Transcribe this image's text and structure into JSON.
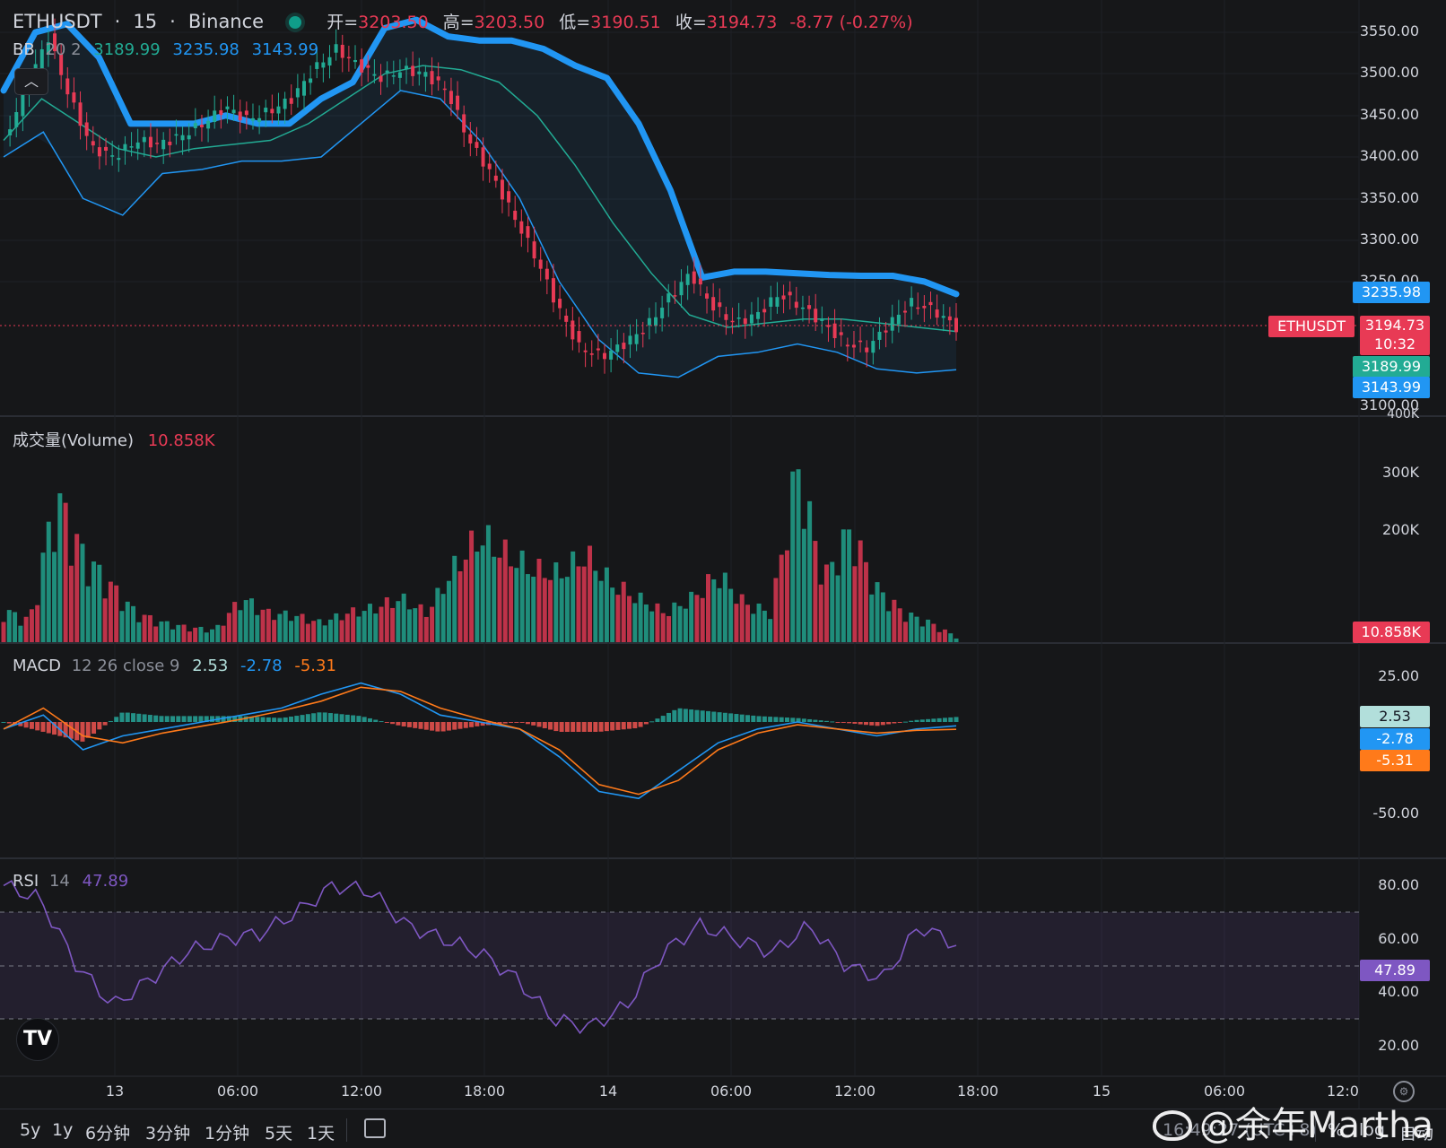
{
  "header": {
    "symbol": "ETHUSDT",
    "interval": "15",
    "exchange": "Binance",
    "sep": "·",
    "open_label": "开=",
    "open": "3203.50",
    "high_label": "高=",
    "high": "3203.50",
    "low_label": "低=",
    "low": "3190.51",
    "close_label": "收=",
    "close": "3194.73",
    "change": "-8.77 (-0.27%)"
  },
  "bb": {
    "name": "BB",
    "params": "20 2",
    "basis": "3189.99",
    "upper": "3235.98",
    "lower": "3143.99"
  },
  "volume": {
    "name": "成交量(Volume)",
    "value": "10.858K"
  },
  "macd": {
    "name": "MACD",
    "params": "12 26 close 9",
    "histogram": "2.53",
    "macd": "-2.78",
    "signal": "-5.31"
  },
  "rsi": {
    "name": "RSI",
    "params": "14",
    "value": "47.89"
  },
  "price_axis": [
    "3550.00",
    "3500.00",
    "3450.00",
    "3400.00",
    "3350.00",
    "3300.00",
    "3250.00",
    "3100.00"
  ],
  "volume_axis": [
    "400K",
    "300K",
    "200K"
  ],
  "macd_axis": [
    "25.00",
    "-50.00"
  ],
  "rsi_axis": [
    "80.00",
    "60.00",
    "40.00",
    "20.00"
  ],
  "tags": {
    "upper": "3235.98",
    "symbol": "ETHUSDT",
    "price": "3194.73",
    "countdown": "10:32",
    "basis": "3189.99",
    "lower": "3143.99",
    "volume": "10.858K",
    "macd_hist": "2.53",
    "macd_line": "-2.78",
    "macd_signal": "-5.31",
    "rsi": "47.89"
  },
  "time_axis": [
    "13",
    "06:00",
    "12:00",
    "18:00",
    "14",
    "06:00",
    "12:00",
    "18:00",
    "15",
    "06:00",
    "12:0"
  ],
  "ranges": [
    "5y",
    "1y",
    "6分钟",
    "3分钟",
    "1分钟",
    "5天",
    "1天"
  ],
  "bottom": {
    "clock": "16:49:27 (UTC+8)",
    "percent": "%",
    "log": "log",
    "auto": "自动"
  },
  "watermark": "@余年Martha",
  "logo": "TV",
  "colors": {
    "up": "#22ab94",
    "down": "#e83a55",
    "bb_upper": "#2196f3",
    "bb_basis": "#22ab94",
    "macd": "#2962ff",
    "signal": "#ff7a1a",
    "rsi": "#7e57c2"
  },
  "chart_data": {
    "type": "candlestick",
    "symbol": "ETHUSDT",
    "interval": "15",
    "y_range": [
      3100,
      3550
    ],
    "x": [
      "13",
      "06:00",
      "12:00",
      "18:00",
      "14",
      "06:00",
      "12:00",
      "18:00"
    ],
    "close_series": [
      3420,
      3480,
      3545,
      3470,
      3410,
      3400,
      3420,
      3415,
      3425,
      3440,
      3460,
      3445,
      3455,
      3470,
      3505,
      3530,
      3510,
      3495,
      3505,
      3500,
      3480,
      3420,
      3380,
      3330,
      3280,
      3220,
      3170,
      3160,
      3175,
      3195,
      3230,
      3260,
      3220,
      3200,
      3210,
      3235,
      3220,
      3200,
      3175,
      3170,
      3200,
      3225,
      3215,
      3195
    ],
    "bb_upper": [
      3480,
      3550,
      3560,
      3520,
      3440,
      3440,
      3440,
      3450,
      3440,
      3440,
      3470,
      3490,
      3555,
      3565,
      3545,
      3540,
      3540,
      3530,
      3510,
      3495,
      3440,
      3360,
      3255,
      3262,
      3262,
      3260,
      3258,
      3257,
      3257,
      3250,
      3235
    ],
    "bb_basis": [
      3420,
      3470,
      3440,
      3410,
      3400,
      3410,
      3415,
      3420,
      3440,
      3470,
      3500,
      3510,
      3505,
      3490,
      3450,
      3390,
      3320,
      3260,
      3210,
      3195,
      3200,
      3205,
      3205,
      3200,
      3195,
      3190
    ],
    "bb_lower": [
      3400,
      3430,
      3350,
      3330,
      3380,
      3385,
      3395,
      3395,
      3400,
      3440,
      3480,
      3470,
      3420,
      3350,
      3250,
      3180,
      3140,
      3135,
      3160,
      3165,
      3175,
      3165,
      3145,
      3140,
      3144
    ],
    "volume_k": [
      65,
      45,
      300,
      180,
      120,
      60,
      40,
      30,
      25,
      90,
      60,
      55,
      40,
      60,
      70,
      90,
      60,
      150,
      220,
      180,
      150,
      140,
      180,
      120,
      90,
      60,
      90,
      140,
      80,
      60,
      360,
      130,
      230,
      110,
      60,
      40,
      10.858
    ],
    "macd_line": [
      -5,
      5,
      -20,
      -10,
      -5,
      0,
      5,
      10,
      20,
      28,
      20,
      5,
      0,
      -5,
      -25,
      -50,
      -55,
      -35,
      -15,
      -5,
      0,
      -5,
      -10,
      -5,
      -2.78
    ],
    "macd_signal": [
      -5,
      10,
      -10,
      -15,
      -8,
      -3,
      2,
      8,
      15,
      25,
      22,
      10,
      2,
      -5,
      -20,
      -45,
      -52,
      -42,
      -20,
      -8,
      -2,
      -5,
      -8,
      -6,
      -5.31
    ],
    "rsi": [
      70,
      65,
      40,
      25,
      35,
      45,
      50,
      52,
      60,
      70,
      68,
      55,
      50,
      45,
      35,
      20,
      17,
      25,
      45,
      55,
      50,
      45,
      55,
      40,
      35,
      55,
      47.89
    ]
  }
}
